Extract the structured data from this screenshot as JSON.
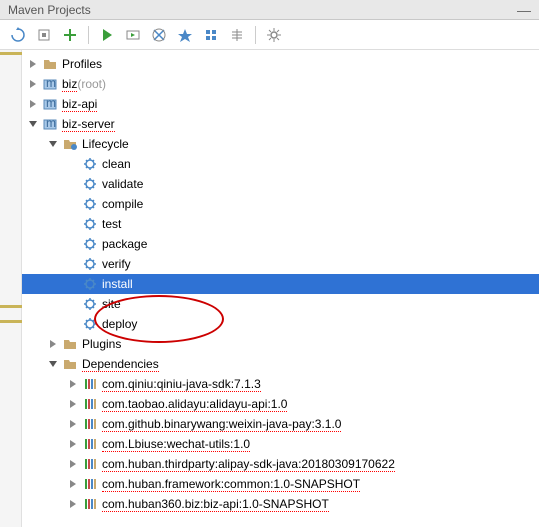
{
  "title": "Maven Projects",
  "toolbar_icons": [
    "reimport",
    "generate",
    "add",
    "run",
    "run2",
    "lifecycle",
    "skip-tests",
    "offline",
    "download",
    "settings-extra",
    "blank",
    "settings"
  ],
  "tree": {
    "profiles": {
      "label": "Profiles"
    },
    "biz_root": {
      "label": "biz",
      "suffix": " (root)"
    },
    "biz_api": {
      "label": "biz-api"
    },
    "biz_server": {
      "label": "biz-server"
    },
    "lifecycle": {
      "label": "Lifecycle",
      "items": [
        "clean",
        "validate",
        "compile",
        "test",
        "package",
        "verify",
        "install",
        "site",
        "deploy"
      ],
      "selected_index": 6
    },
    "plugins": {
      "label": "Plugins"
    },
    "dependencies": {
      "label": "Dependencies",
      "items": [
        "com.qiniu:qiniu-java-sdk:7.1.3",
        "com.taobao.alidayu:alidayu-api:1.0",
        "com.github.binarywang:weixin-java-pay:3.1.0",
        "com.Lbiuse:wechat-utils:1.0",
        "com.huban.thirdparty:alipay-sdk-java:20180309170622",
        "com.huban.framework:common:1.0-SNAPSHOT",
        "com.huban360.biz:biz-api:1.0-SNAPSHOT"
      ]
    }
  }
}
